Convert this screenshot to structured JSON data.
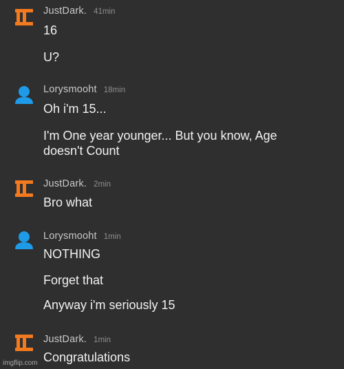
{
  "colors": {
    "background": "#2f2f2f",
    "justdark_avatar": "#f37a1f",
    "lory_avatar": "#1e9be8"
  },
  "messages": [
    {
      "user": "JustDark.",
      "time": "41min",
      "avatar_icon": "orange-logo-icon",
      "lines": [
        "16",
        "U?"
      ]
    },
    {
      "user": "Lorysmooht",
      "time": "18min",
      "avatar_icon": "blue-user-icon",
      "lines": [
        "Oh i'm 15...",
        "I'm One year younger... But you know, Age",
        "doesn't Count"
      ]
    },
    {
      "user": "JustDark.",
      "time": "2min",
      "avatar_icon": "orange-logo-icon",
      "lines": [
        "Bro what"
      ]
    },
    {
      "user": "Lorysmooht",
      "time": "1min",
      "avatar_icon": "blue-user-icon",
      "lines": [
        "NOTHING",
        "Forget that",
        "Anyway i'm seriously 15"
      ]
    },
    {
      "user": "JustDark.",
      "time": "1min",
      "avatar_icon": "orange-logo-icon",
      "lines": [
        "Congratulations"
      ]
    }
  ],
  "watermark": "imgflip.com"
}
